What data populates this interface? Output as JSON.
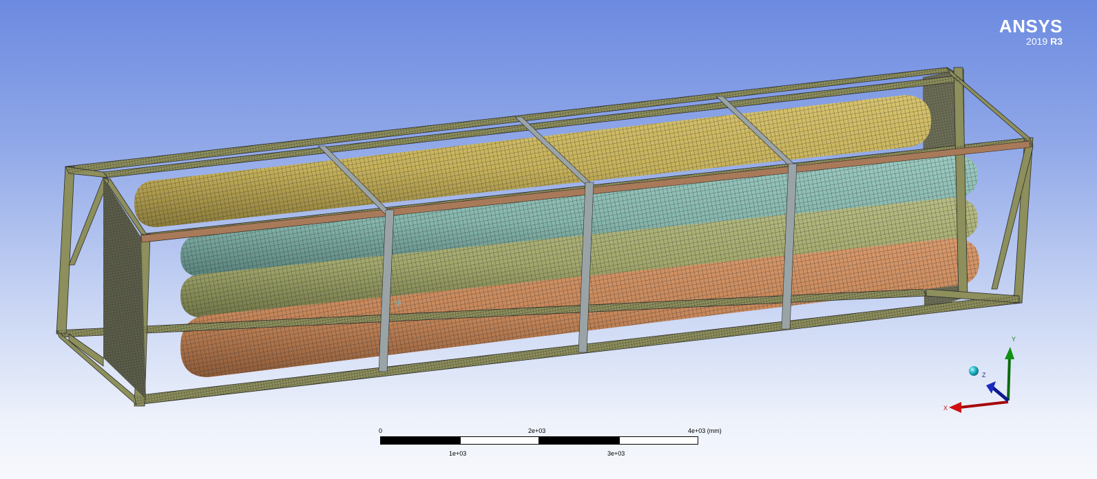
{
  "logo": {
    "brand": "ANSYS",
    "version_year": "2019",
    "version_release": "R3"
  },
  "scale_bar": {
    "label_0": "0",
    "label_1": "1e+03",
    "label_2": "2e+03",
    "label_3": "3e+03",
    "label_4": "4e+03 (mm)"
  },
  "triad": {
    "x_label": "X",
    "y_label": "Y",
    "z_label": "Z"
  },
  "colors": {
    "frame": "#8d8f5c",
    "tank_yellow": "#c9b55e",
    "tank_teal": "#87b9b0",
    "tank_olive": "#a9ae72",
    "tank_orange": "#c98a5f",
    "rail": "#a87a5a",
    "strap": "#9aa4a6",
    "mesh": "#303030",
    "axis_x": "#d01010",
    "axis_y": "#108010",
    "axis_z": "#1020b0",
    "sphere": "#20b8c8"
  }
}
